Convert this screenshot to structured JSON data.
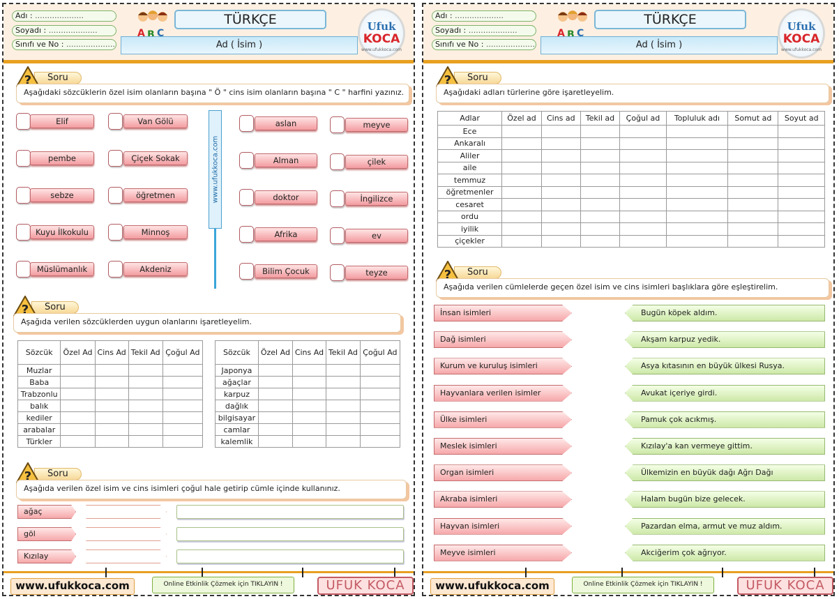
{
  "header": {
    "name_label": "Adı :",
    "surname_label": "Soyadı :",
    "class_label": "Sınıfı ve No :",
    "dots": "....................",
    "title": "TÜRKÇE",
    "subtitle": "Ad ( İsim )",
    "logo_top": "Ufuk",
    "logo_bottom": "KOCA",
    "logo_url": "www.ufukkoca.com"
  },
  "soru_label": "Soru",
  "left": {
    "q1": "Aşağıdaki sözcüklerin özel isim olanların başına \" Ö \" cins isim olanların başına \" C \" harfini yazınız.",
    "words_col1": [
      "Elif",
      "pembe",
      "sebze",
      "Kuyu İlkokulu",
      "Müslümanlık"
    ],
    "words_col2": [
      "Van Gölü",
      "Çiçek Sokak",
      "öğretmen",
      "Minnoş",
      "Akdeniz"
    ],
    "words_col3": [
      "aslan",
      "Alman",
      "doktor",
      "Afrika",
      "Bilim Çocuk"
    ],
    "words_col4": [
      "meyve",
      "çilek",
      "İngilizce",
      "ev",
      "teyze"
    ],
    "vertical_web": "www.ufukkoca.com",
    "q2": "Aşağıda verilen sözcüklerden uygun olanlarını işaretleyelim.",
    "t_headers": [
      "Sözcük",
      "Özel Ad",
      "Cins Ad",
      "Tekil Ad",
      "Çoğul Ad"
    ],
    "t1_rows": [
      "Muzlar",
      "Baba",
      "Trabzonlu",
      "balık",
      "kediler",
      "arabalar",
      "Türkler"
    ],
    "t2_rows": [
      "Japonya",
      "ağaçlar",
      "karpuz",
      "dağlık",
      "bilgisayar",
      "camlar",
      "kalemlik"
    ],
    "q3": "Aşağıda verilen özel isim ve cins isimleri çoğul hale getirip cümle içinde kullanınız.",
    "plural_words": [
      "ağaç",
      "göl",
      "Kızılay"
    ]
  },
  "right": {
    "q1": "Aşağıdaki adları türlerine göre işaretleyelim.",
    "t_headers": [
      "Adlar",
      "Özel ad",
      "Cins ad",
      "Tekil ad",
      "Çoğul ad",
      "Topluluk adı",
      "Somut ad",
      "Soyut ad"
    ],
    "t_rows": [
      "Ece",
      "Ankaralı",
      "Aliler",
      "aile",
      "temmuz",
      "öğretmenler",
      "cesaret",
      "ordu",
      "iyilik",
      "çiçekler"
    ],
    "q2": "Aşağıda verilen cümlelerde geçen özel isim ve cins isimleri başlıklara göre eşleştirelim.",
    "categories": [
      "İnsan isimleri",
      "Dağ isimleri",
      "Kurum ve kuruluş isimleri",
      "Hayvanlara verilen isimler",
      "Ülke isimleri",
      "Meslek isimleri",
      "Organ isimleri",
      "Akraba isimleri",
      "Hayvan isimleri",
      "Meyve isimleri"
    ],
    "sentences": [
      "Bugün köpek aldım.",
      "Akşam karpuz yedik.",
      "Asya kıtasının en büyük ülkesi Rusya.",
      "Avukat içeriye girdi.",
      "Pamuk çok acıkmış.",
      "Kızılay'a kan vermeye gittim.",
      "Ülkemizin en büyük dağı Ağrı Dağı",
      "Halam bugün bize gelecek.",
      "Pazardan elma, armut ve muz aldım.",
      "Akciğerim çok ağrıyor."
    ]
  },
  "footer": {
    "www": "www.ufukkoca.com",
    "online": "Online Etkinlik Çözmek için TIKLAYIN !",
    "brand": "UFUK KOCA"
  }
}
